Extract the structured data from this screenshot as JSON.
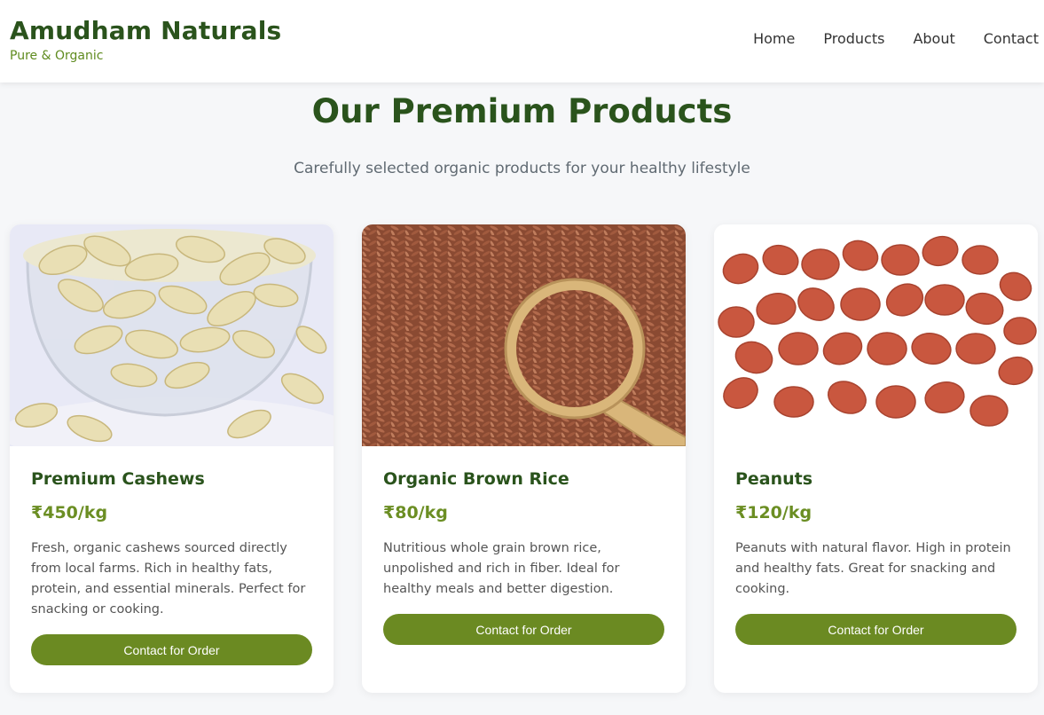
{
  "brand": {
    "title": "Amudham Naturals",
    "tagline": "Pure & Organic",
    "title_color": "#2a531c",
    "tagline_color": "#5f8b1f"
  },
  "nav": {
    "items": [
      "Home",
      "Products",
      "About",
      "Contact"
    ]
  },
  "section": {
    "title": "Our Premium Products",
    "subtitle": "Carefully selected organic products for your healthy lifestyle"
  },
  "products": [
    {
      "name": "Premium Cashews",
      "price": "₹450/kg",
      "description": "Fresh, organic cashews sourced directly from local farms. Rich in healthy fats, protein, and essential minerals. Perfect for snacking or cooking.",
      "button": "Contact for Order",
      "image": "cashews-in-glass-bowl"
    },
    {
      "name": "Organic Brown Rice",
      "price": "₹80/kg",
      "description": "Nutritious whole grain brown rice, unpolished and rich in fiber. Ideal for healthy meals and better digestion.",
      "button": "Contact for Order",
      "image": "brown-rice-with-wooden-spoon"
    },
    {
      "name": "Peanuts",
      "price": "₹120/kg",
      "description": "Peanuts with natural flavor. High in protein and healthy fats. Great for snacking and cooking.",
      "button": "Contact for Order",
      "image": "red-peanuts-pile"
    }
  ],
  "colors": {
    "heading": "#2a531c",
    "price": "#6b8e23",
    "button": "#6b8a22",
    "background": "#f6f7f9"
  }
}
